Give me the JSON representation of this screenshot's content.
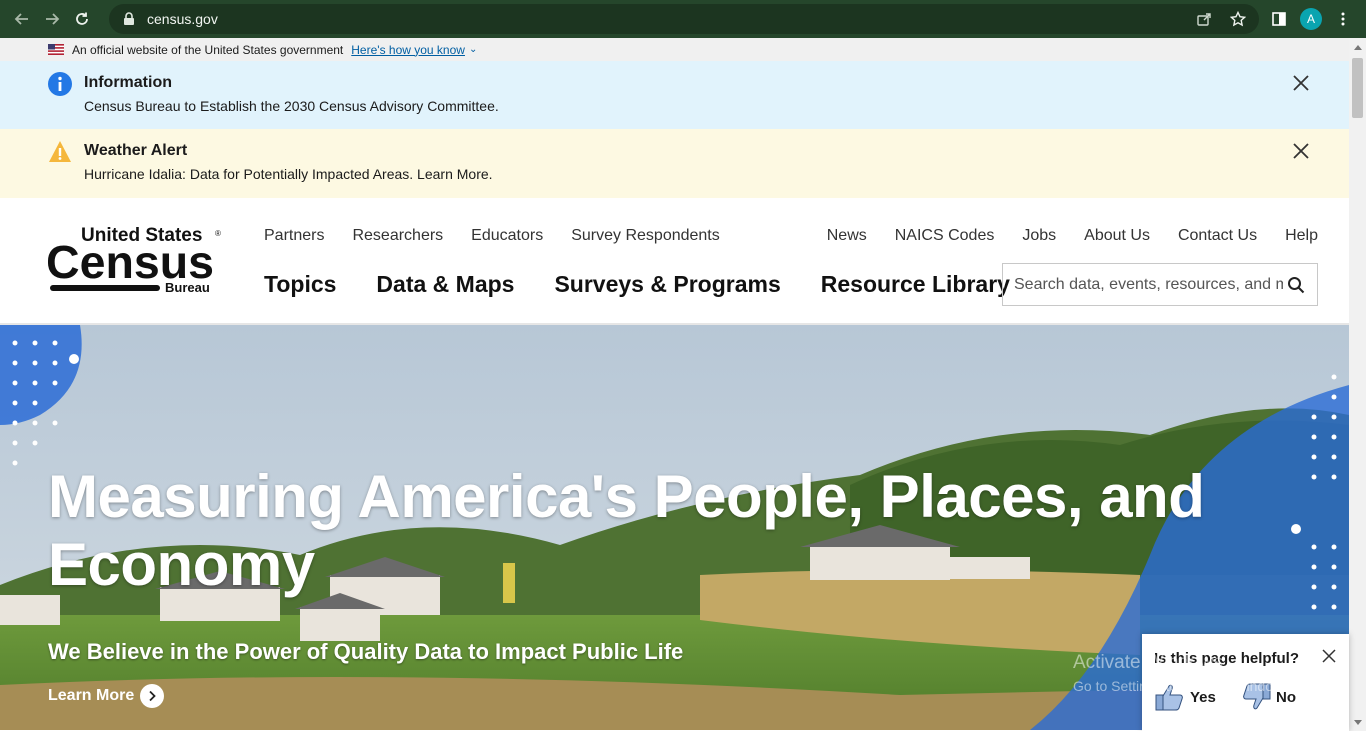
{
  "browser": {
    "url": "census.gov",
    "profile_initial": "A"
  },
  "gov_banner": {
    "text": "An official website of the United States government",
    "link": "Here's how you know"
  },
  "alerts": [
    {
      "title": "Information",
      "text": "Census Bureau to Establish the 2030 Census Advisory Committee."
    },
    {
      "title": "Weather Alert",
      "text": "Hurricane Idalia: Data for Potentially Impacted Areas. Learn More."
    }
  ],
  "logo": {
    "line1": "United States",
    "line2": "Census",
    "line3": "Bureau",
    "mark": "®"
  },
  "utility_nav_left": [
    "Partners",
    "Researchers",
    "Educators",
    "Survey Respondents"
  ],
  "utility_nav_right": [
    "News",
    "NAICS Codes",
    "Jobs",
    "About Us",
    "Contact Us",
    "Help"
  ],
  "main_nav": [
    "Topics",
    "Data & Maps",
    "Surveys & Programs",
    "Resource Library"
  ],
  "search": {
    "placeholder": "Search data, events, resources, and more"
  },
  "hero": {
    "title": "Measuring America's People, Places, and Economy",
    "subtitle": "We Believe in the Power of Quality Data to Impact Public Life",
    "cta": "Learn More"
  },
  "feedback": {
    "question": "Is this page helpful?",
    "yes": "Yes",
    "no": "No"
  },
  "watermark": {
    "line1": "Activate Windows",
    "line2": "Go to Settings to activate Windows."
  },
  "colors": {
    "chrome": "#25462b",
    "info_bg": "#e1f3fc",
    "weather_bg": "#fdf9e2",
    "link": "#005ea2",
    "accent_blue": "#2b6cd6"
  }
}
